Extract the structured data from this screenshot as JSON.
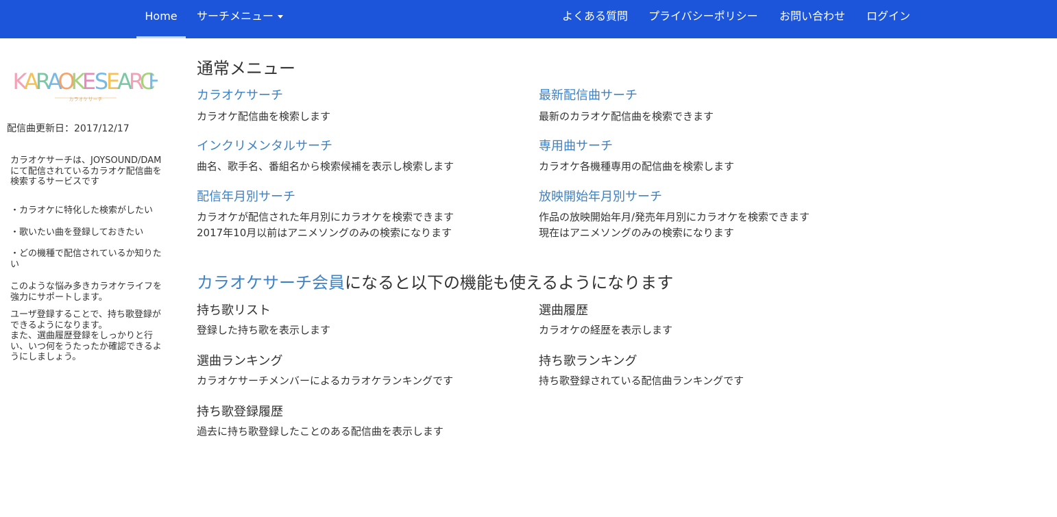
{
  "nav": {
    "home": "Home",
    "search_menu": "サーチメニュー",
    "faq": "よくある質問",
    "privacy": "プライバシーポリシー",
    "contact": "お問い合わせ",
    "login": "ログイン"
  },
  "sidebar": {
    "logo_text": "KARAOKE SEARCH",
    "logo_sub": "カラオケサーチ",
    "update": "配信曲更新日：2017/12/17",
    "intro": "カラオケサーチは、JOYSOUND/DAMにて配信されているカラオケ配信曲を検索するサービスです",
    "bullets": [
      "・カラオケに特化した検索がしたい",
      "・歌いたい曲を登録しておきたい",
      "・どの機種で配信されているか知りたい"
    ],
    "support": "このような悩み多きカラオケライフを強力にサポートします。",
    "register": "ユーザ登録することで、持ち歌登録ができるようになります。",
    "history": "また、選曲履歴登録をしっかりと行い、いつ何をうたったか確認できるようにしましょう。"
  },
  "main": {
    "normal_title": "通常メニュー",
    "menu": [
      {
        "title": "カラオケサーチ",
        "desc": "カラオケ配信曲を検索します"
      },
      {
        "title": "最新配信曲サーチ",
        "desc": "最新のカラオケ配信曲を検索できます"
      },
      {
        "title": "インクリメンタルサーチ",
        "desc": "曲名、歌手名、番組名から検索候補を表示し検索します"
      },
      {
        "title": "専用曲サーチ",
        "desc": "カラオケ各機種専用の配信曲を検索します"
      },
      {
        "title": "配信年月別サーチ",
        "desc": "カラオケが配信された年月別にカラオケを検索できます",
        "desc2": "2017年10月以前はアニメソングのみの検索になります"
      },
      {
        "title": "放映開始年月別サーチ",
        "desc": "作品の放映開始年月/発売年月別にカラオケを検索できます",
        "desc2": "現在はアニメソングのみの検索になります"
      }
    ],
    "member_link": "カラオケサーチ会員",
    "member_text": "になると以下の機能も使えるようになります",
    "member_menu": [
      {
        "title": "持ち歌リスト",
        "desc": "登録した持ち歌を表示します"
      },
      {
        "title": "選曲履歴",
        "desc": "カラオケの経歴を表示します"
      },
      {
        "title": "選曲ランキング",
        "desc": "カラオケサーチメンバーによるカラオケランキングです"
      },
      {
        "title": "持ち歌ランキング",
        "desc": "持ち歌登録されている配信曲ランキングです"
      },
      {
        "title": "持ち歌登録履歴",
        "desc": "過去に持ち歌登録したことのある配信曲を表示します"
      }
    ]
  },
  "colors": {
    "nav_bg": "#1d55da",
    "link": "#3d82c7",
    "text": "#333333"
  }
}
